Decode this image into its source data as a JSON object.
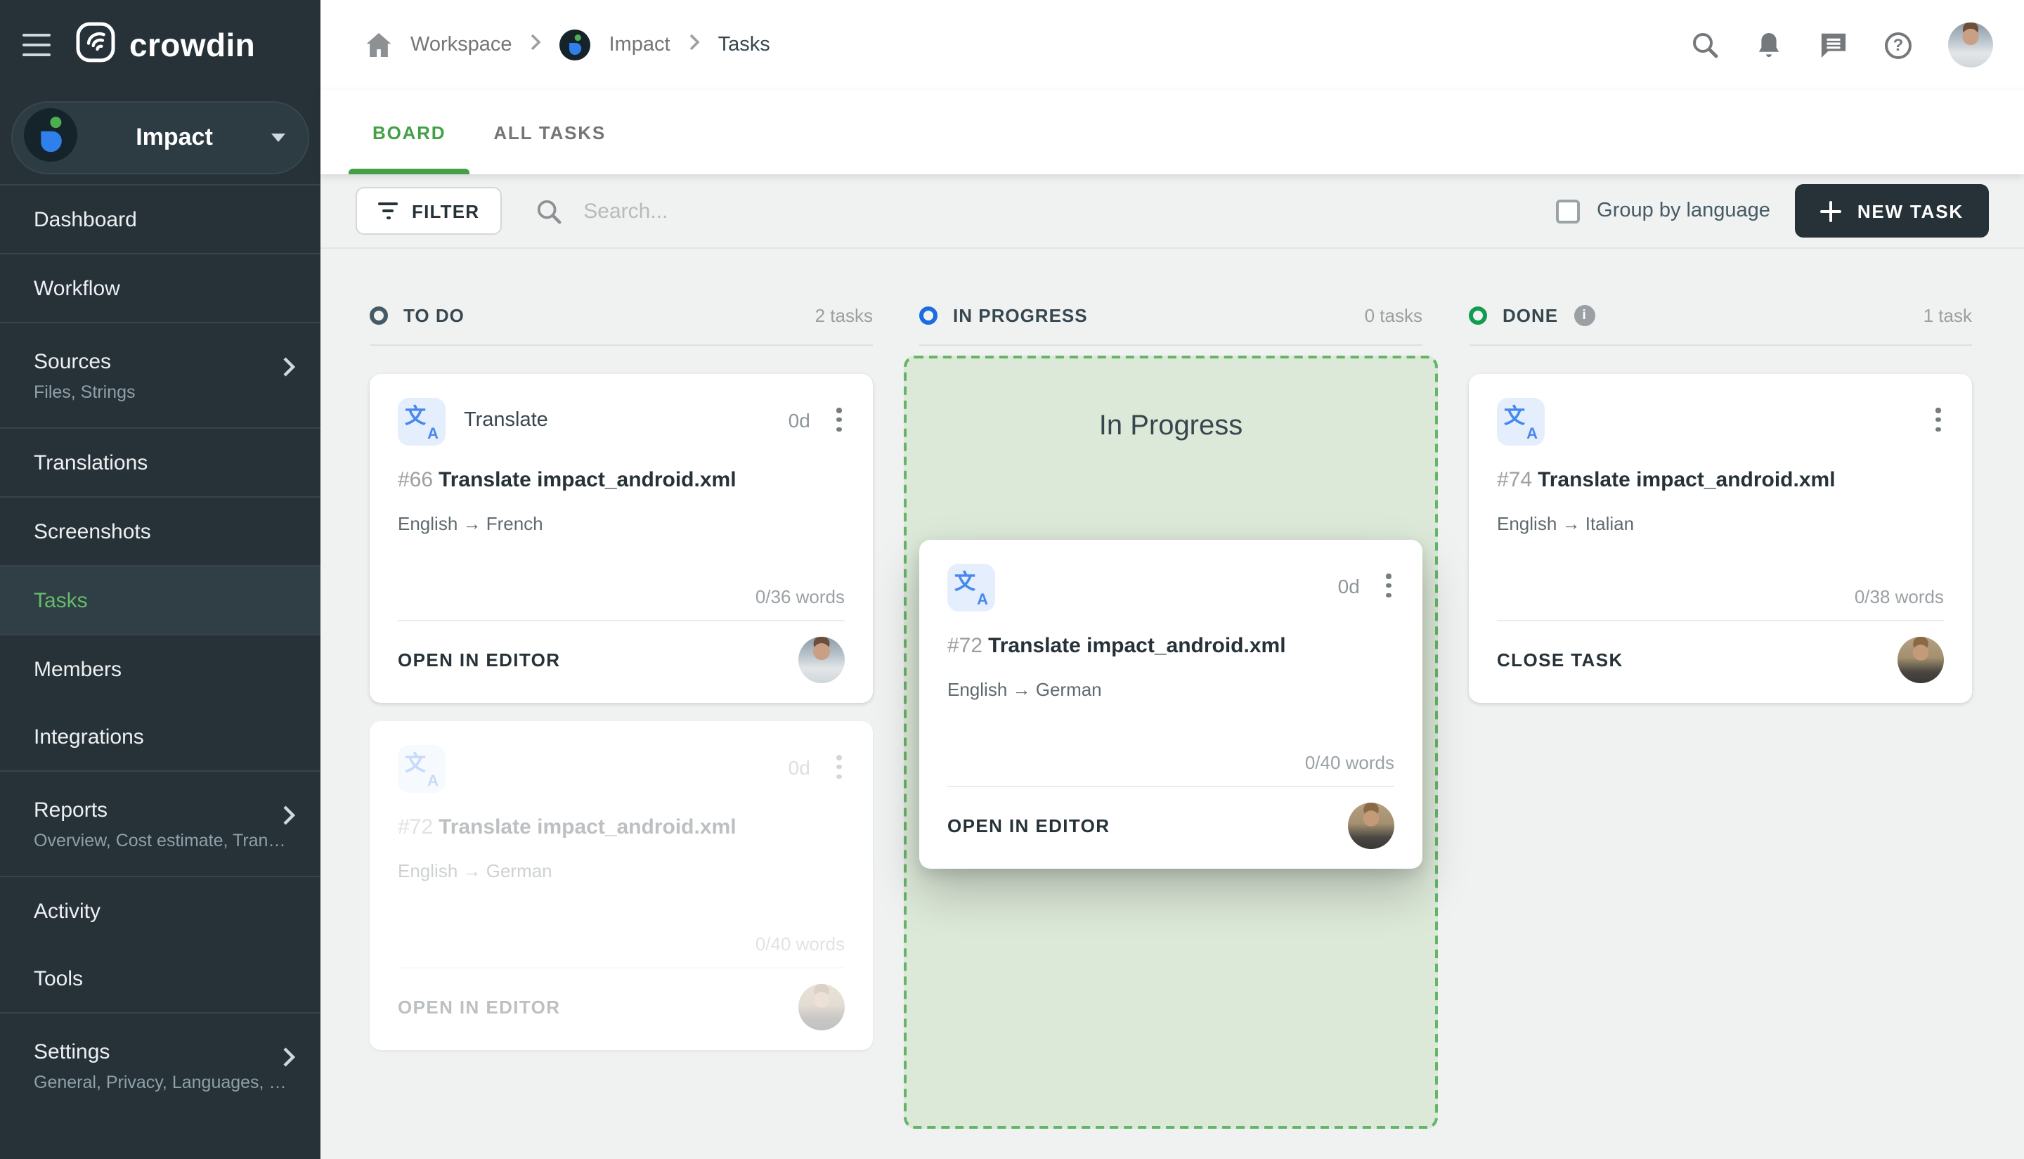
{
  "app": {
    "logo_text": "crowdin"
  },
  "icons": {
    "info": "i",
    "question": "?",
    "translate_zh": "文",
    "translate_latin": "A"
  },
  "breadcrumb": {
    "items": [
      "Workspace",
      "Impact",
      "Tasks"
    ]
  },
  "tabs": [
    {
      "label": "BOARD",
      "active": true
    },
    {
      "label": "ALL TASKS",
      "active": false
    }
  ],
  "toolbar": {
    "filter": "FILTER",
    "search_placeholder": "Search...",
    "group_by": "Group by language",
    "new_task": "NEW TASK"
  },
  "sidebar": {
    "project": "Impact",
    "items": [
      {
        "label": "Dashboard"
      },
      {
        "label": "Workflow"
      },
      {
        "label": "Sources",
        "sub": "Files, Strings"
      },
      {
        "label": "Translations"
      },
      {
        "label": "Screenshots"
      },
      {
        "label": "Tasks",
        "active": true
      },
      {
        "label": "Members"
      },
      {
        "label": "Integrations"
      },
      {
        "label": "Reports",
        "sub": "Overview, Cost estimate, Transl…"
      },
      {
        "label": "Activity"
      },
      {
        "label": "Tools"
      },
      {
        "label": "Settings",
        "sub": "General, Privacy, Languages, Q…"
      }
    ]
  },
  "board": {
    "columns": [
      {
        "name": "TO DO",
        "count": "2 tasks"
      },
      {
        "name": "IN PROGRESS",
        "count": "0 tasks"
      },
      {
        "name": "DONE",
        "count": "1 task"
      }
    ],
    "dropzone_label": "In Progress",
    "cards": {
      "c66": {
        "type": "Translate",
        "due": "0d",
        "id": "#66",
        "title": "Translate impact_android.xml",
        "languages": "English → French",
        "words": "0/36 words",
        "action": "OPEN IN EDITOR"
      },
      "c72": {
        "due": "0d",
        "id": "#72",
        "title": "Translate impact_android.xml",
        "languages": "English → German",
        "words": "0/40 words",
        "action": "OPEN IN EDITOR"
      },
      "c74": {
        "id": "#74",
        "title": "Translate impact_android.xml",
        "languages": "English → Italian",
        "words": "0/38 words",
        "action": "CLOSE TASK"
      }
    }
  },
  "colors": {
    "accent_green": "#43a047",
    "todo_circle": "#455a64",
    "progress_circle": "#1a6ce0",
    "done_circle": "#119c52",
    "sidebar_bg": "#263238",
    "dropzone_bg": "#dce8d8",
    "dropzone_border": "#64b567"
  }
}
